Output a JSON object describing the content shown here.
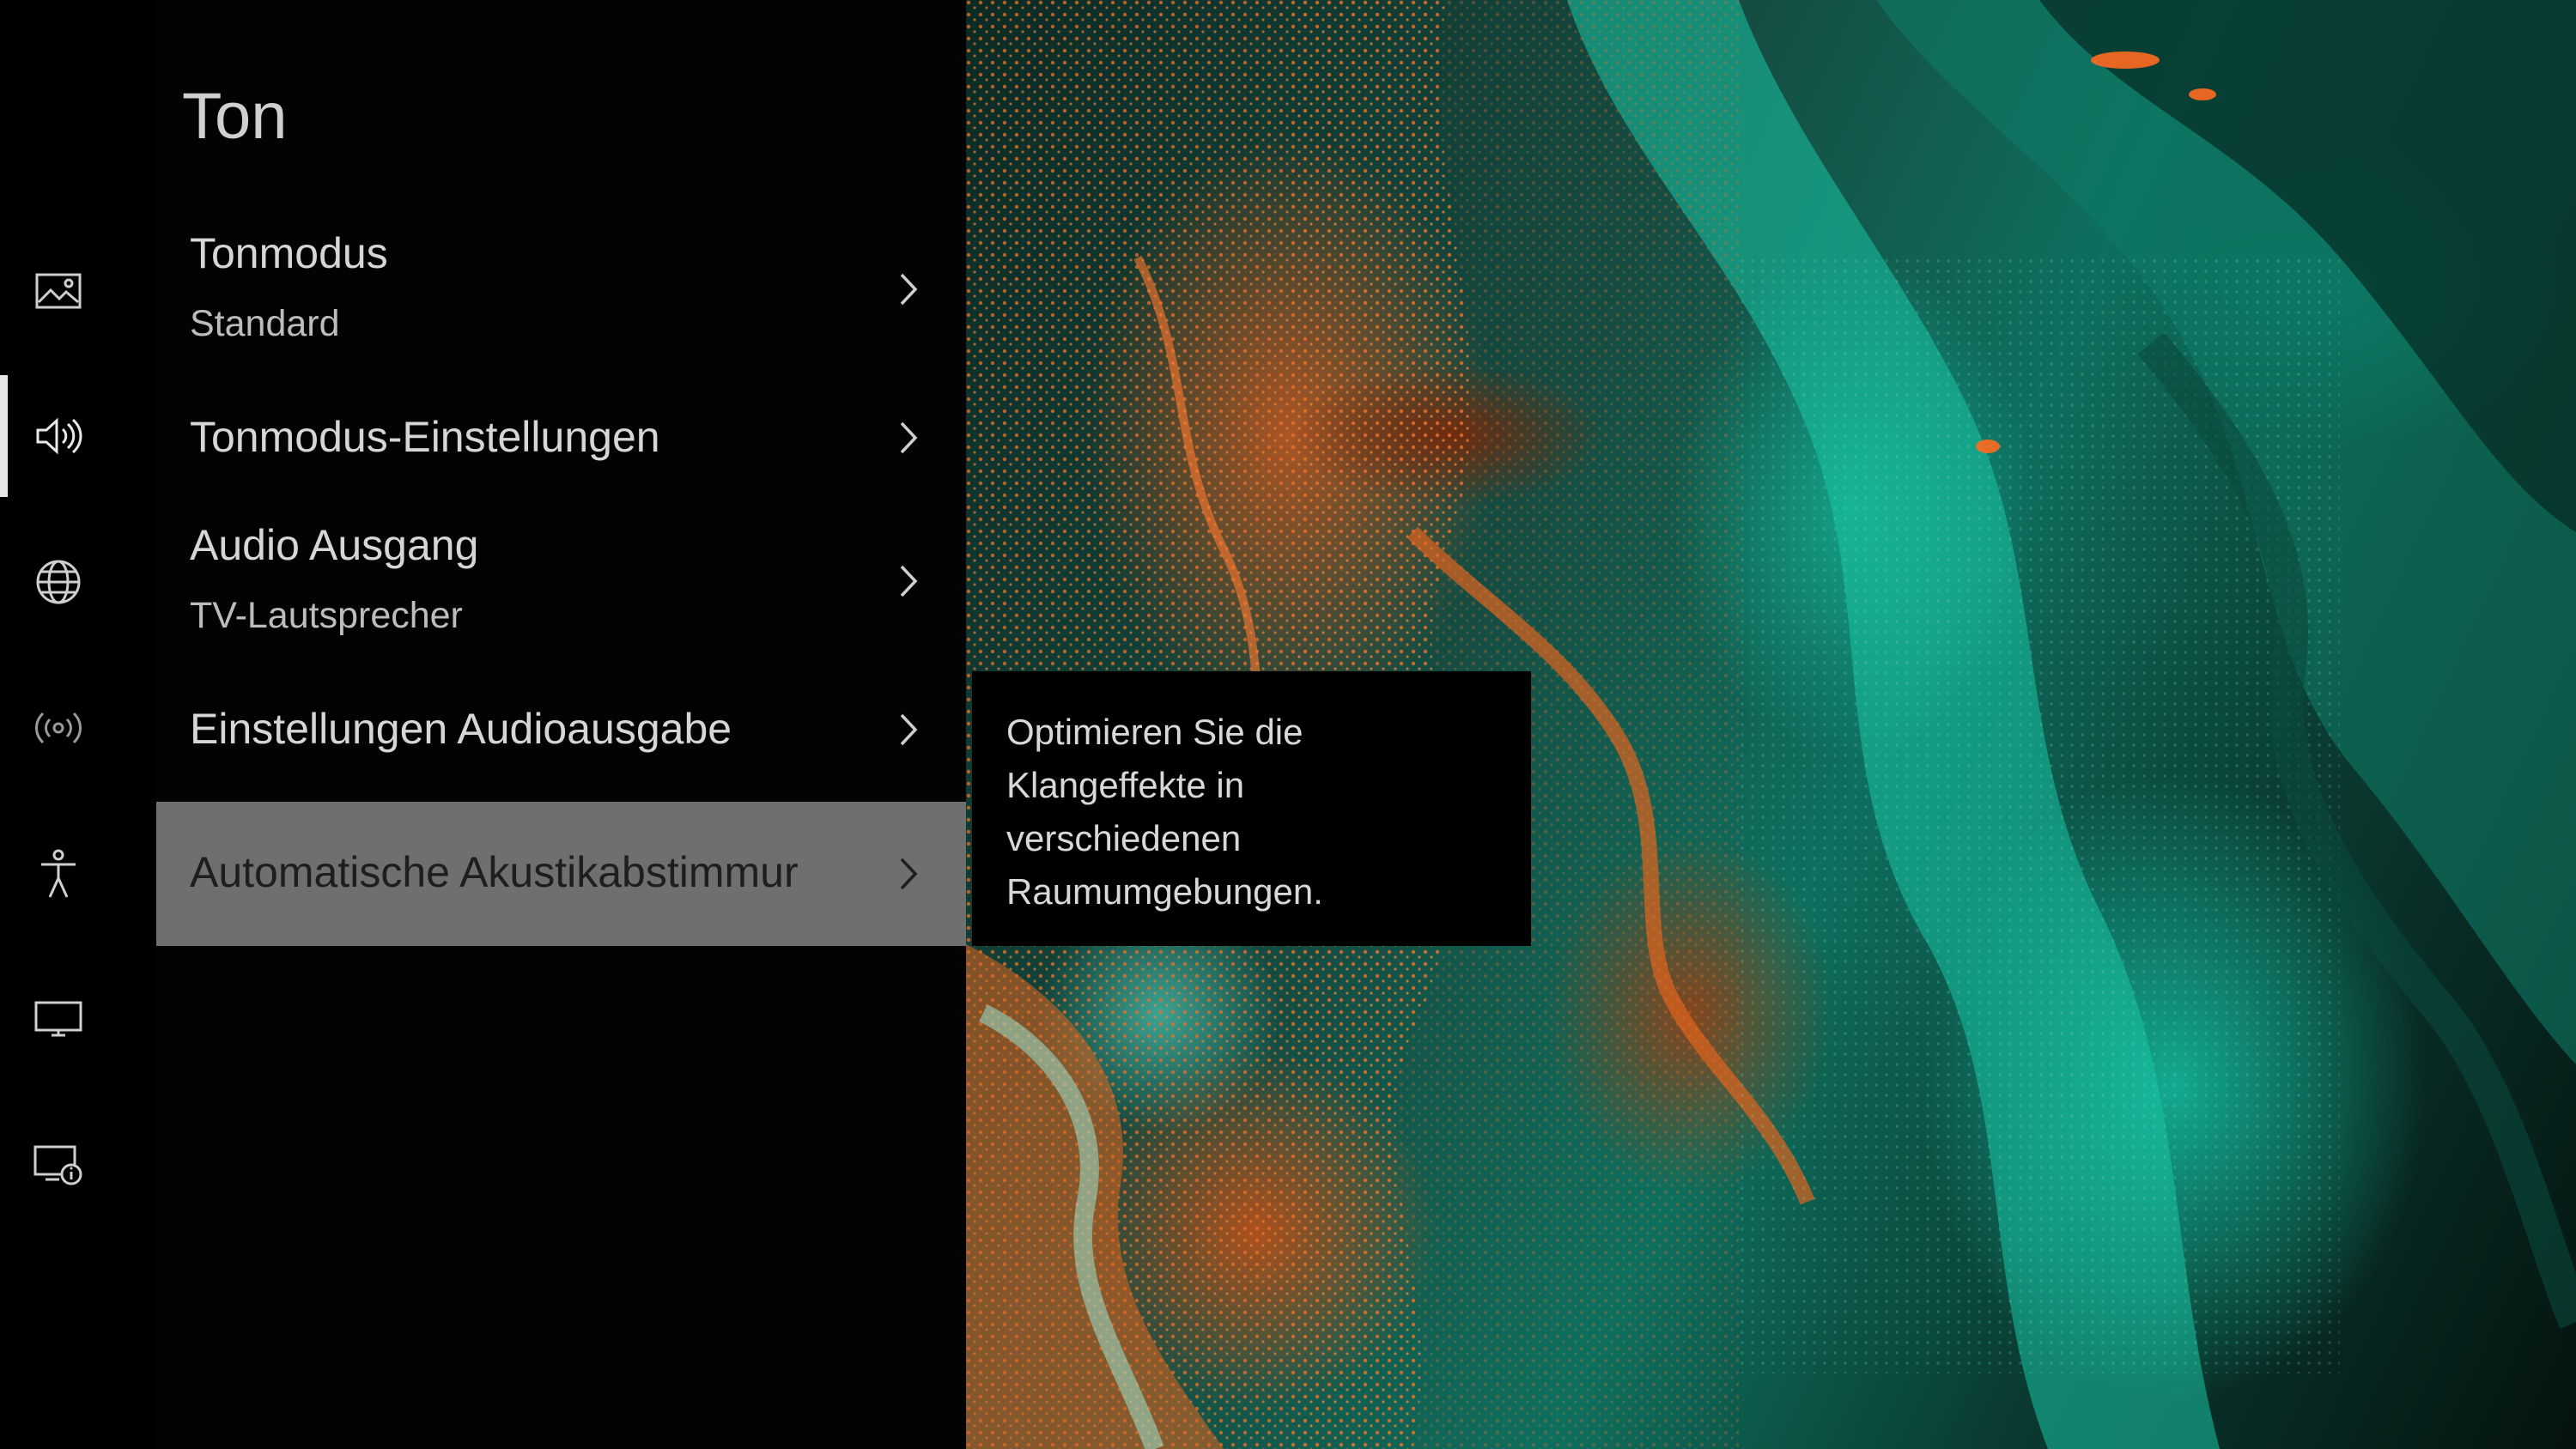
{
  "menu": {
    "title": "Ton",
    "items": [
      {
        "label": "Tonmodus",
        "value": "Standard"
      },
      {
        "label": "Tonmodus-Einstellungen"
      },
      {
        "label": "Audio Ausgang",
        "value": "TV-Lautsprecher"
      },
      {
        "label": "Einstellungen Audioausgabe"
      },
      {
        "label": "Automatische Akustikabstimmur",
        "selected": true
      }
    ]
  },
  "sidebar": {
    "icons": [
      "picture-icon",
      "sound-icon",
      "globe-icon",
      "wireless-broadcast-icon",
      "accessibility-icon",
      "display-icon",
      "device-info-icon"
    ],
    "active": "sound-icon"
  },
  "tooltip": {
    "text": "Optimieren Sie die\nKlangeffekte in\nverschiedenen\nRaumumgebungen."
  },
  "colors": {
    "background": "#000000",
    "selected_item": "#6f6f6f",
    "text": "#d6d6d6",
    "artwork_teal": "#14b89c",
    "artwork_orange": "#e0641e"
  }
}
